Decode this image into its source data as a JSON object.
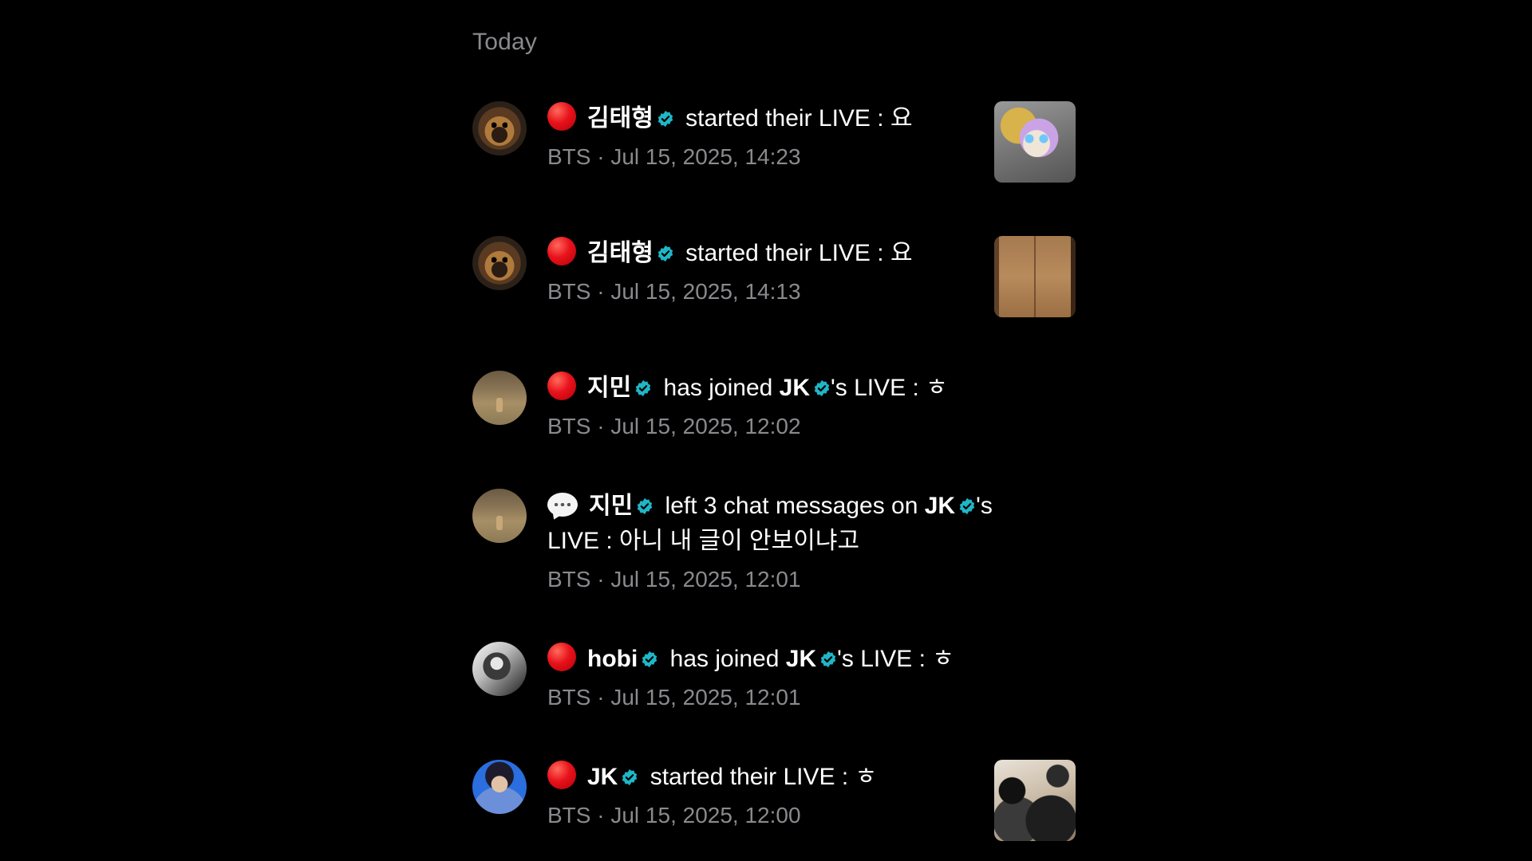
{
  "section_title": "Today",
  "colors": {
    "background": "#000000",
    "primary_text": "#ffffff",
    "secondary_text": "#8a8a8e",
    "verified_badge": "#1fb6c6",
    "live_dot": "#e8121b"
  },
  "notifications": [
    {
      "icon": "live-dot-icon",
      "avatar": "pomeranian-avatar",
      "name": "김태형",
      "text": "started their LIVE : 요",
      "group": "BTS",
      "timestamp": "Jul 15, 2025, 14:23",
      "thumbnail": "plush-toy-thumbnail"
    },
    {
      "icon": "live-dot-icon",
      "avatar": "pomeranian-avatar",
      "name": "김태형",
      "text": "started their LIVE : 요",
      "group": "BTS",
      "timestamp": "Jul 15, 2025, 14:13",
      "thumbnail": "wooden-box-thumbnail"
    },
    {
      "icon": "live-dot-icon",
      "avatar": "field-dog-avatar",
      "name": "지민",
      "text_before": "has joined",
      "target": "JK",
      "text_after": "'s LIVE : ㅎ",
      "group": "BTS",
      "timestamp": "Jul 15, 2025, 12:02"
    },
    {
      "icon": "chat-bubble-icon",
      "avatar": "field-dog-avatar",
      "name": "지민",
      "text_before": "left 3 chat messages on",
      "target": "JK",
      "text_after": "'s",
      "text_line2": "LIVE : 아니 내 글이 안보이냐고",
      "group": "BTS",
      "timestamp": "Jul 15, 2025, 12:01"
    },
    {
      "icon": "live-dot-icon",
      "avatar": "monochrome-portrait-avatar",
      "name": "hobi",
      "text_before": "has joined",
      "target": "JK",
      "text_after": "'s LIVE : ㅎ",
      "group": "BTS",
      "timestamp": "Jul 15, 2025, 12:01"
    },
    {
      "icon": "live-dot-icon",
      "avatar": "blue-portrait-avatar",
      "name": "JK",
      "text": "started their LIVE : ㅎ",
      "group": "BTS",
      "timestamp": "Jul 15, 2025, 12:00",
      "thumbnail": "people-thumbnail"
    }
  ]
}
